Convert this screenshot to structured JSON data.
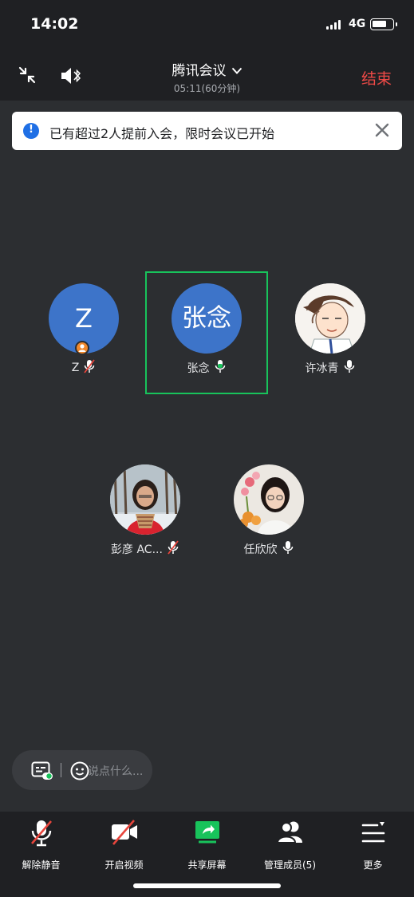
{
  "status_bar": {
    "time": "14:02",
    "network": "4G",
    "battery_level": 0.65
  },
  "header": {
    "title": "腾讯会议",
    "duration": "05:11(60分钟)",
    "end_label": "结束",
    "minimize_icon": "minimize-arrows-icon",
    "speaker_icon": "speaker-bluetooth-icon",
    "accent_color": "#f04a47"
  },
  "notice": {
    "text": "已有超过2人提前入会，限时会议已开始",
    "icon": "info-icon",
    "close_icon": "close-icon"
  },
  "participants": [
    {
      "name": "Z",
      "avatar_text": "Z",
      "mic": "muted",
      "host": true,
      "avatar_type": "letter"
    },
    {
      "name": "张念",
      "avatar_text": "张念",
      "mic": "speaking",
      "host": false,
      "avatar_type": "letter",
      "active": true
    },
    {
      "name": "许冰青",
      "mic": "on",
      "avatar_type": "photo-cartoon"
    },
    {
      "name": "彭彦 AC...",
      "mic": "muted",
      "avatar_type": "photo-portrait"
    },
    {
      "name": "任欣欣",
      "mic": "on",
      "avatar_type": "photo-portrait"
    }
  ],
  "chat": {
    "placeholder": "说点什么...",
    "caption_icon": "subtitle-icon",
    "emoji_icon": "emoji-icon"
  },
  "toolbar": {
    "unmute_label": "解除静音",
    "video_label": "开启视频",
    "share_label": "共享屏幕",
    "members_label": "管理成员(5)",
    "more_label": "更多"
  },
  "colors": {
    "active_border": "#18c35b",
    "muted_red": "#e8453c",
    "speaking_green": "#18c35b",
    "avatar_blue": "#3d74c9"
  }
}
